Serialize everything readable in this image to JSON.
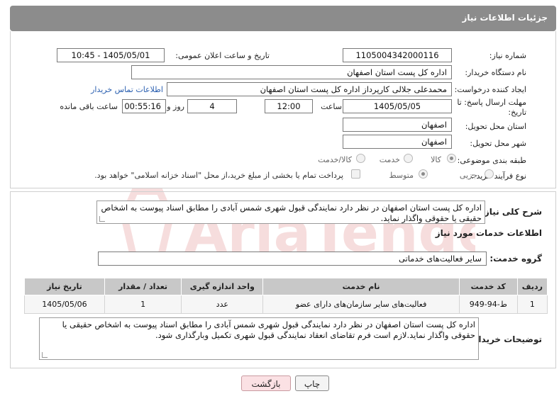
{
  "header": {
    "title": "جزئیات اطلاعات نیاز"
  },
  "form": {
    "need_number": {
      "label": "شماره نیاز:",
      "value": "1105004342000116"
    },
    "announce_datetime": {
      "label": "تاریخ و ساعت اعلان عمومی:",
      "value": "1405/05/01 - 10:45"
    },
    "buyer_org": {
      "label": "نام دستگاه خریدار:",
      "value": "اداره کل پست استان اصفهان"
    },
    "requester": {
      "label": "ایجاد کننده درخواست:",
      "value": "محمدعلی جلالی کارپرداز اداره کل پست استان اصفهان",
      "contact_link": "اطلاعات تماس خریدار"
    },
    "deadline": {
      "label_line1": "مهلت ارسال پاسخ: تا",
      "label_line2": "تاریخ:",
      "date": "1405/05/05",
      "time_label": "ساعت",
      "time": "12:00",
      "days": "4",
      "days_label": "روز و",
      "remaining": "00:55:16",
      "remaining_label": "ساعت باقی مانده"
    },
    "delivery_province": {
      "label": "استان محل تحویل:",
      "value": "اصفهان"
    },
    "delivery_city": {
      "label": "شهر محل تحویل:",
      "value": "اصفهان"
    },
    "category": {
      "label": "طبقه بندی موضوعی:",
      "options": [
        "کالا",
        "خدمت",
        "کالا/خدمت"
      ],
      "selected": "کالا"
    },
    "purchase_type": {
      "label": "نوع فرآیند خرید :",
      "options": [
        "جزیی",
        "متوسط"
      ],
      "selected": "متوسط",
      "payment_note": "پرداخت تمام یا بخشی از مبلغ خرید،از محل \"اسناد خزانه اسلامی\" خواهد بود."
    }
  },
  "summary": {
    "label": "شرح کلی نیاز:",
    "text": "اداره کل پست استان اصفهان در نظر دارد  نمایندگی قبول شهری شمس آبادی را  مطابق اسناد پیوست به اشخاص حقیقی یا حقوقی واگذار نماید."
  },
  "services": {
    "section_title": "اطلاعات خدمات مورد نیاز",
    "group_label": "گروه خدمت:",
    "group_value": "سایر فعالیت‌های خدماتی",
    "columns": [
      "ردیف",
      "کد خدمت",
      "نام خدمت",
      "واحد اندازه گیری",
      "تعداد / مقدار",
      "تاریخ نیاز"
    ],
    "rows": [
      {
        "idx": "1",
        "code": "ط-94-949",
        "name": "فعالیت‌های سایر سازمان‌های دارای عضو",
        "unit": "عدد",
        "qty": "1",
        "date": "1405/05/06"
      }
    ]
  },
  "buyer_notes": {
    "label": "توضیحات خریدار:",
    "text": "اداره کل پست استان اصفهان در نظر دارد  نمایندگی قبول شهری شمس آبادی را  مطابق اسناد پیوست به اشخاص حقیقی یا حقوقی واگذار نماید.لازم است فرم تقاضای انعقاد نمایندگی قبول شهری تکمیل وبارگذاری شود."
  },
  "buttons": {
    "print": "چاپ",
    "back": "بازگشت"
  },
  "colors": {
    "header_bg": "#8c8c8c",
    "table_header_bg": "#c8c8c8",
    "back_button_bg": "#fbe1e4",
    "link": "#2a5fb0"
  }
}
